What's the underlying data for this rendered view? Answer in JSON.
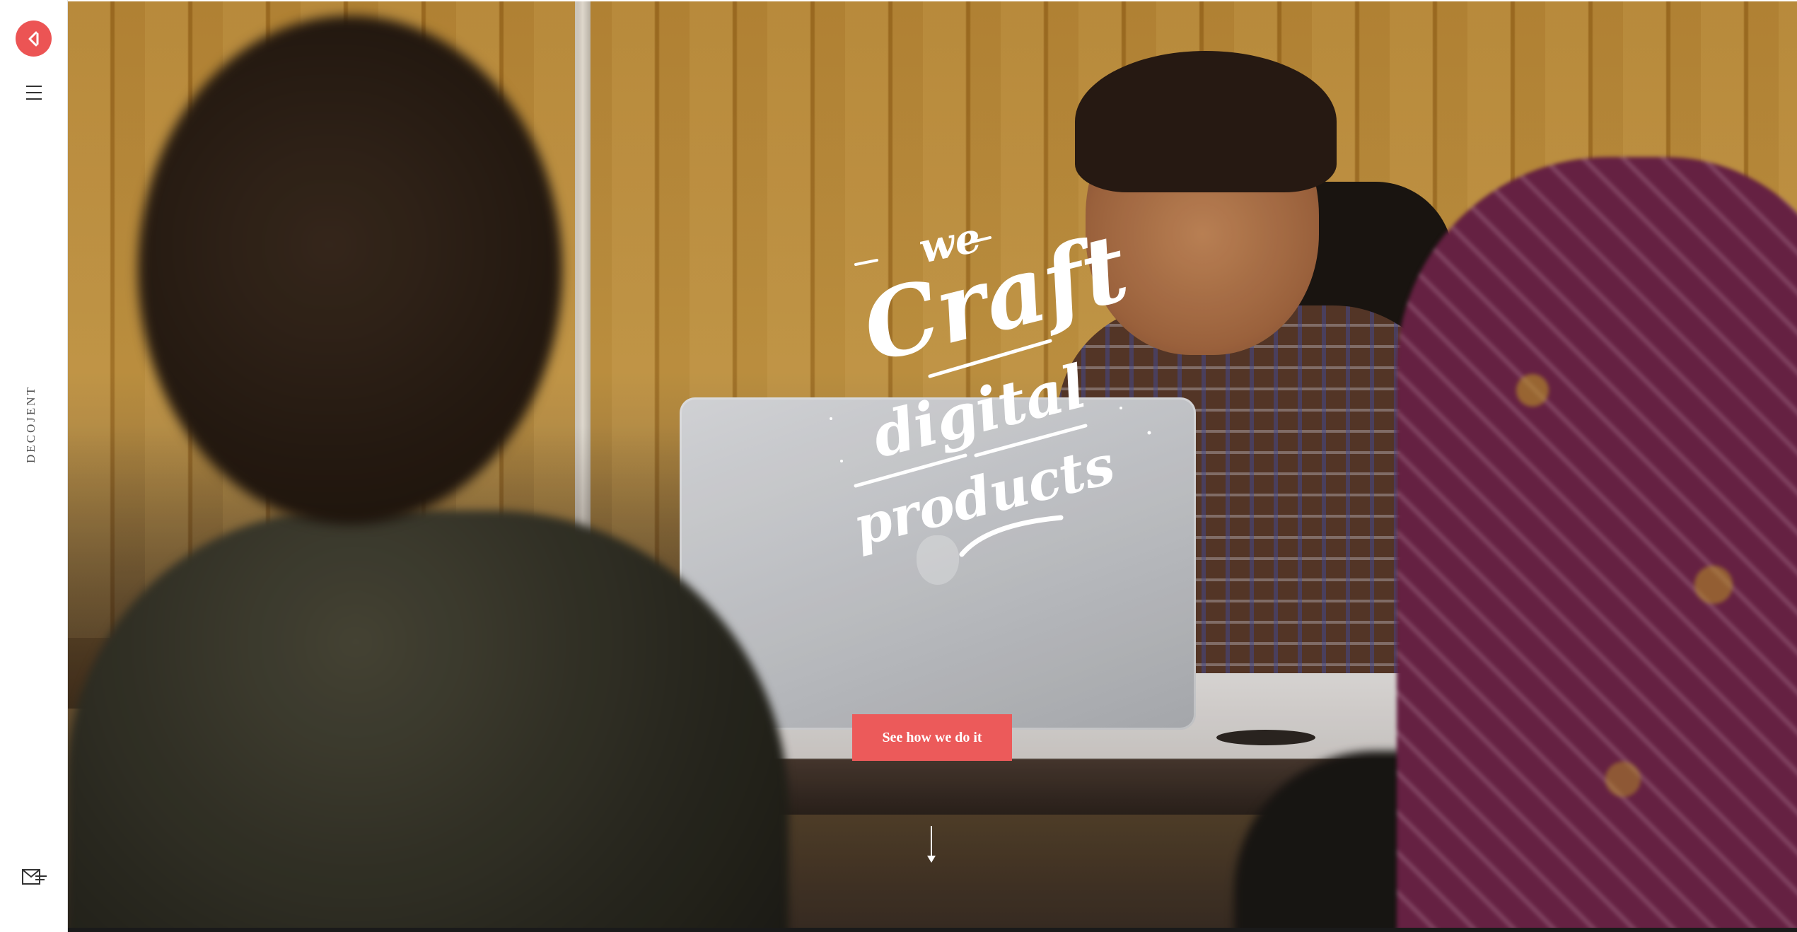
{
  "sidebar": {
    "logo_icon": "play-back-logo-icon",
    "menu_icon": "hamburger-menu-icon",
    "brand": "DECOJENT",
    "mail_icon": "mail-send-icon"
  },
  "hero": {
    "headline": {
      "line1": "we",
      "line2": "Craft",
      "line3": "digital",
      "line4": "products"
    },
    "cta_label": "See how we do it",
    "scroll_icon": "arrow-down-icon"
  },
  "colors": {
    "accent": "#ec5454",
    "sidebar_bg": "#ffffff",
    "headline": "#ffffff"
  }
}
